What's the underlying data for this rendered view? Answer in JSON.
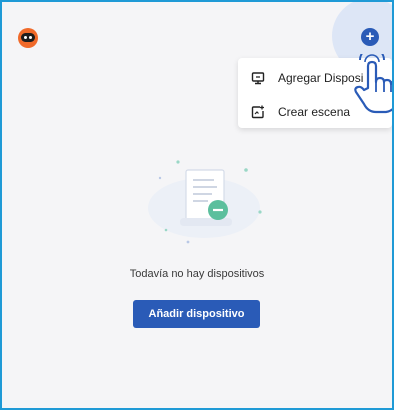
{
  "menu": {
    "items": [
      {
        "label": "Agregar Disposi",
        "icon": "monitor-plus-icon"
      },
      {
        "label": "Crear escena",
        "icon": "image-plus-icon"
      }
    ]
  },
  "empty_state": {
    "message": "Todavía no hay dispositivos",
    "button_label": "Añadir dispositivo"
  },
  "colors": {
    "accent": "#2a5bb7",
    "frame_border": "#1f9ad6",
    "logo": "#f06a2a",
    "background": "#f5f5f7"
  },
  "icons": {
    "logo": "robot-logo-icon",
    "add": "plus-circle-icon",
    "cursor": "hand-pointer-icon",
    "illustration": "document-illustration"
  }
}
